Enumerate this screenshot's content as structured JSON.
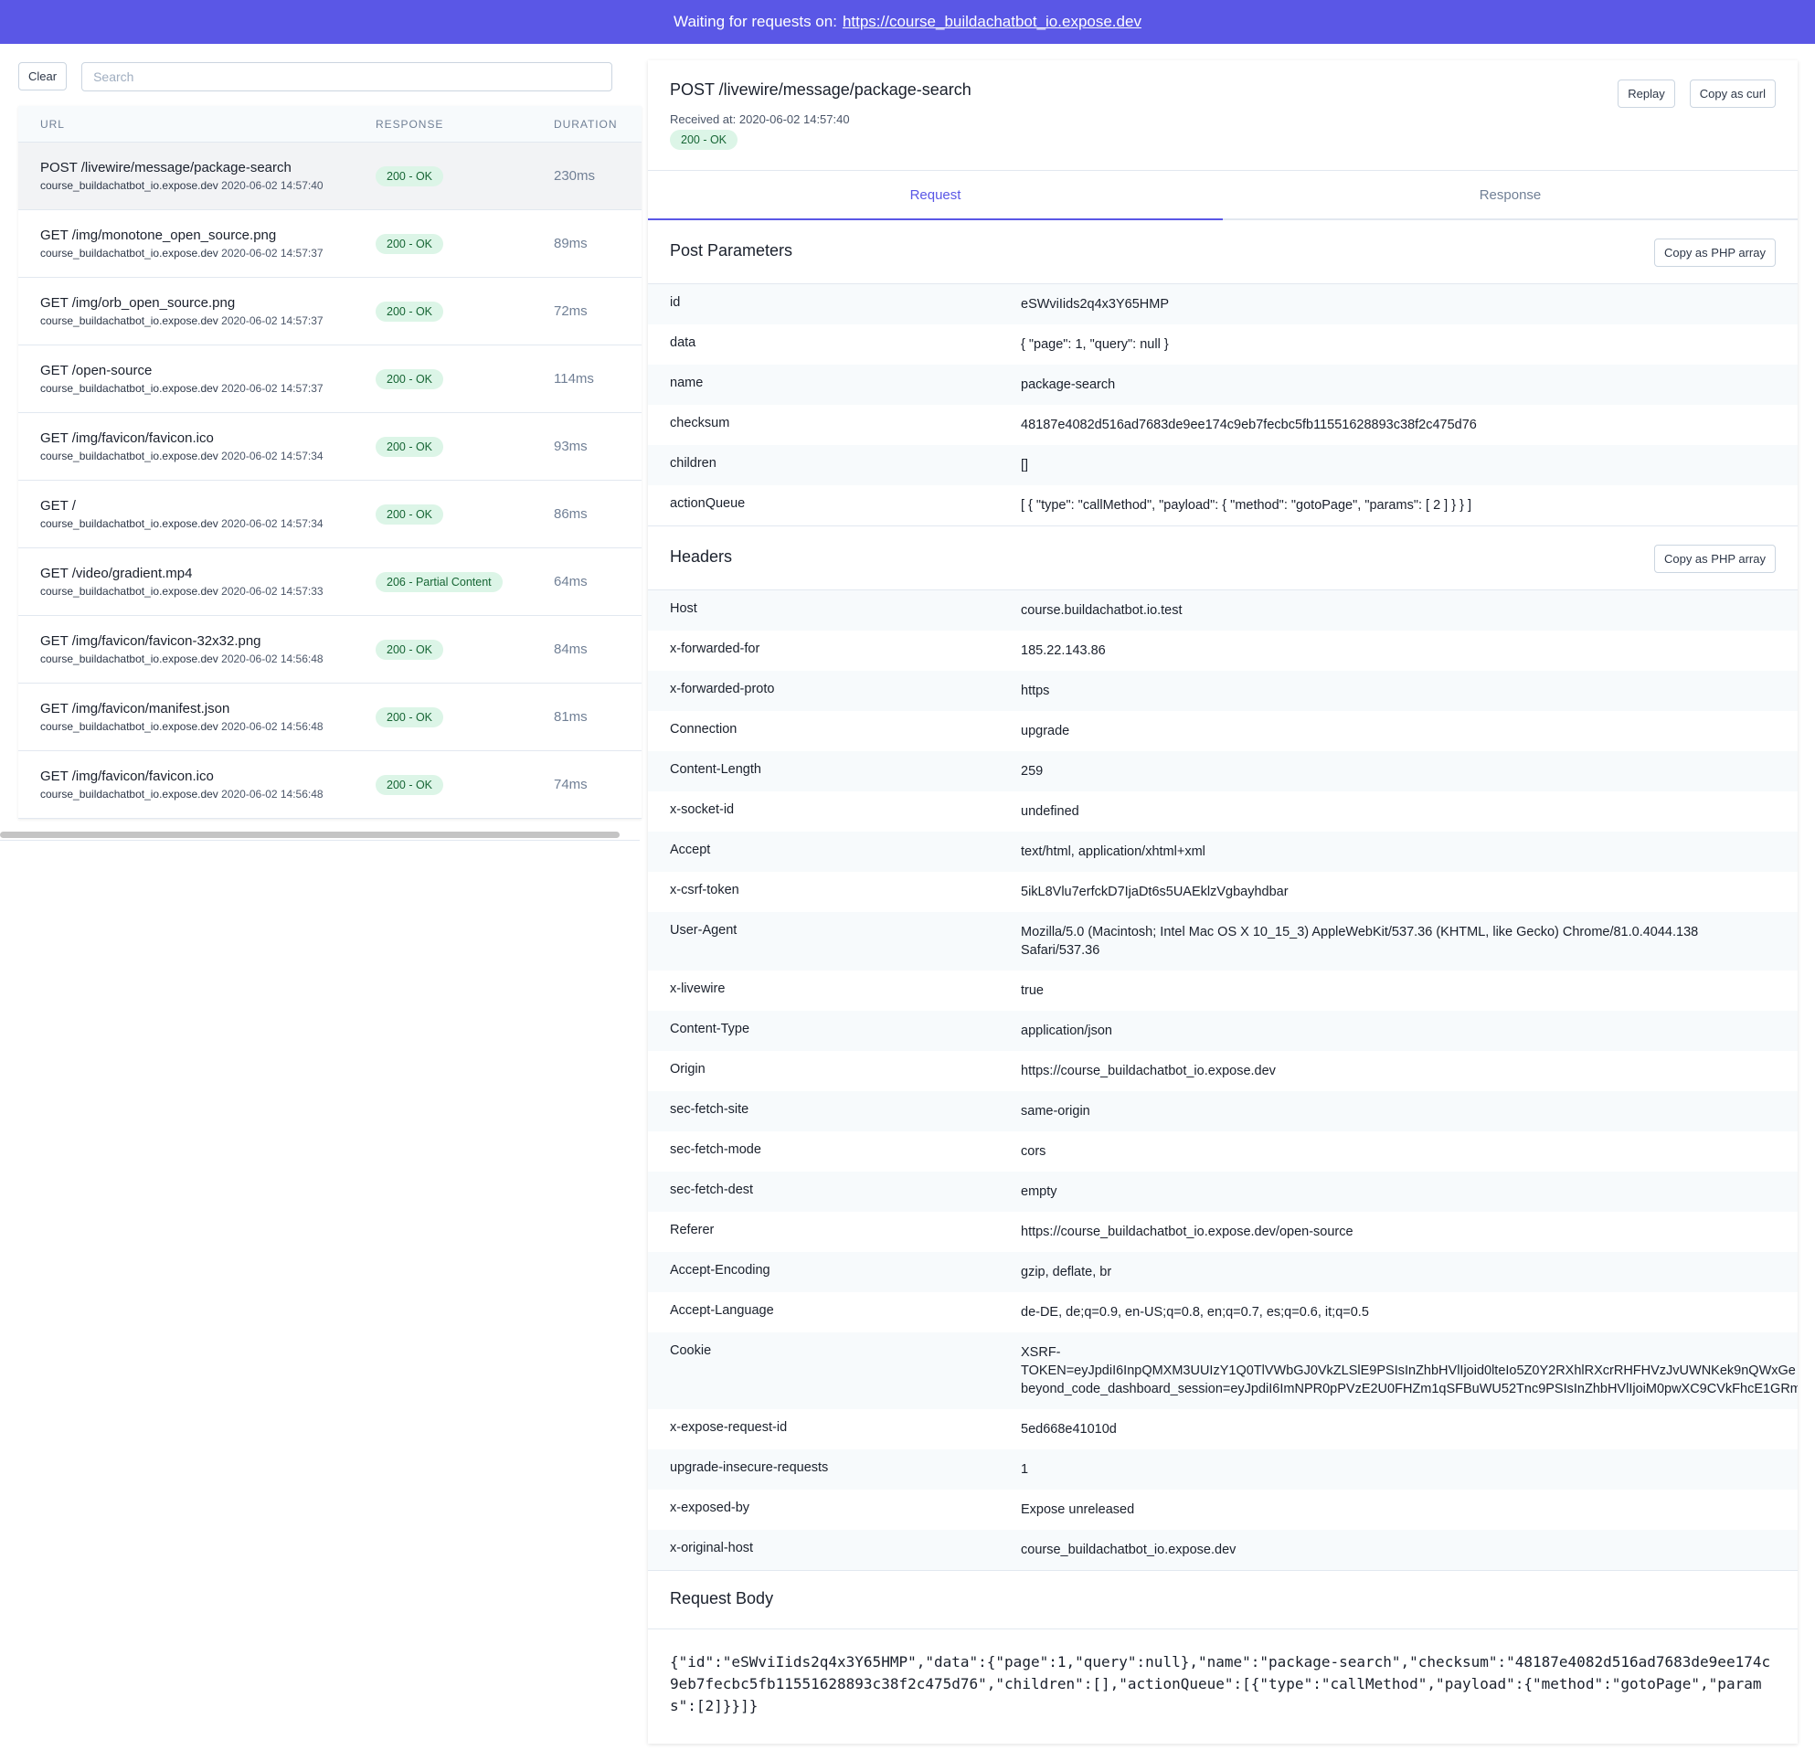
{
  "topbar": {
    "prefix": "Waiting for requests on:",
    "url": "https://course_buildachatbot_io.expose.dev"
  },
  "sidebar": {
    "clear_label": "Clear",
    "search_placeholder": "Search",
    "columns": {
      "url": "URL",
      "response": "RESPONSE",
      "duration": "DURATION"
    },
    "requests": [
      {
        "method_path": "POST /livewire/message/package-search",
        "host": "course_buildachatbot_io.expose.dev",
        "time": "2020-06-02 14:57:40",
        "status": "200 - OK",
        "duration": "230ms"
      },
      {
        "method_path": "GET /img/monotone_open_source.png",
        "host": "course_buildachatbot_io.expose.dev",
        "time": "2020-06-02 14:57:37",
        "status": "200 - OK",
        "duration": "89ms"
      },
      {
        "method_path": "GET /img/orb_open_source.png",
        "host": "course_buildachatbot_io.expose.dev",
        "time": "2020-06-02 14:57:37",
        "status": "200 - OK",
        "duration": "72ms"
      },
      {
        "method_path": "GET /open-source",
        "host": "course_buildachatbot_io.expose.dev",
        "time": "2020-06-02 14:57:37",
        "status": "200 - OK",
        "duration": "114ms"
      },
      {
        "method_path": "GET /img/favicon/favicon.ico",
        "host": "course_buildachatbot_io.expose.dev",
        "time": "2020-06-02 14:57:34",
        "status": "200 - OK",
        "duration": "93ms"
      },
      {
        "method_path": "GET /",
        "host": "course_buildachatbot_io.expose.dev",
        "time": "2020-06-02 14:57:34",
        "status": "200 - OK",
        "duration": "86ms"
      },
      {
        "method_path": "GET /video/gradient.mp4",
        "host": "course_buildachatbot_io.expose.dev",
        "time": "2020-06-02 14:57:33",
        "status": "206 - Partial Content",
        "duration": "64ms"
      },
      {
        "method_path": "GET /img/favicon/favicon-32x32.png",
        "host": "course_buildachatbot_io.expose.dev",
        "time": "2020-06-02 14:56:48",
        "status": "200 - OK",
        "duration": "84ms"
      },
      {
        "method_path": "GET /img/favicon/manifest.json",
        "host": "course_buildachatbot_io.expose.dev",
        "time": "2020-06-02 14:56:48",
        "status": "200 - OK",
        "duration": "81ms"
      },
      {
        "method_path": "GET /img/favicon/favicon.ico",
        "host": "course_buildachatbot_io.expose.dev",
        "time": "2020-06-02 14:56:48",
        "status": "200 - OK",
        "duration": "74ms"
      }
    ]
  },
  "detail": {
    "title": "POST /livewire/message/package-search",
    "received": "Received at: 2020-06-02 14:57:40",
    "status": "200 - OK",
    "replay_label": "Replay",
    "copy_curl_label": "Copy as curl",
    "tabs": {
      "request": "Request",
      "response": "Response"
    },
    "post_params": {
      "title": "Post Parameters",
      "copy_label": "Copy as PHP array",
      "rows": [
        {
          "key": "id",
          "value": "eSWviIids2q4x3Y65HMP"
        },
        {
          "key": "data",
          "value": "{ \"page\": 1, \"query\": null }"
        },
        {
          "key": "name",
          "value": "package-search"
        },
        {
          "key": "checksum",
          "value": "48187e4082d516ad7683de9ee174c9eb7fecbc5fb11551628893c38f2c475d76"
        },
        {
          "key": "children",
          "value": "[]"
        },
        {
          "key": "actionQueue",
          "value": "[ { \"type\": \"callMethod\", \"payload\": { \"method\": \"gotoPage\", \"params\": [ 2 ] } } ]"
        }
      ]
    },
    "headers": {
      "title": "Headers",
      "copy_label": "Copy as PHP array",
      "rows": [
        {
          "key": "Host",
          "value": "course.buildachatbot.io.test"
        },
        {
          "key": "x-forwarded-for",
          "value": "185.22.143.86"
        },
        {
          "key": "x-forwarded-proto",
          "value": "https"
        },
        {
          "key": "Connection",
          "value": "upgrade"
        },
        {
          "key": "Content-Length",
          "value": "259"
        },
        {
          "key": "x-socket-id",
          "value": "undefined"
        },
        {
          "key": "Accept",
          "value": "text/html, application/xhtml+xml"
        },
        {
          "key": "x-csrf-token",
          "value": "5ikL8Vlu7erfckD7IjaDt6s5UAEklzVgbayhdbar"
        },
        {
          "key": "User-Agent",
          "value": "Mozilla/5.0 (Macintosh; Intel Mac OS X 10_15_3) AppleWebKit/537.36 (KHTML, like Gecko) Chrome/81.0.4044.138 Safari/537.36"
        },
        {
          "key": "x-livewire",
          "value": "true"
        },
        {
          "key": "Content-Type",
          "value": "application/json"
        },
        {
          "key": "Origin",
          "value": "https://course_buildachatbot_io.expose.dev"
        },
        {
          "key": "sec-fetch-site",
          "value": "same-origin"
        },
        {
          "key": "sec-fetch-mode",
          "value": "cors"
        },
        {
          "key": "sec-fetch-dest",
          "value": "empty"
        },
        {
          "key": "Referer",
          "value": "https://course_buildachatbot_io.expose.dev/open-source"
        },
        {
          "key": "Accept-Encoding",
          "value": "gzip, deflate, br"
        },
        {
          "key": "Accept-Language",
          "value": "de-DE, de;q=0.9, en-US;q=0.8, en;q=0.7, es;q=0.6, it;q=0.5"
        },
        {
          "key": "Cookie",
          "value_lines": [
            "XSRF-",
            "TOKEN=eyJpdiI6InpQMXM3UUIzY1Q0TlVWbGJ0VkZLSlE9PSIsInZhbHVlIjoid0lteIo5Z0Y2RXhlRXcrRHFHVzJvUWNKek9nQWxGe",
            "beyond_code_dashboard_session=eyJpdiI6ImNPR0pPVzE2U0FHZm1qSFBuWU52Tnc9PSIsInZhbHVlIjoiM0pwXC9CVkFhcE1GRm"
          ]
        },
        {
          "key": "x-expose-request-id",
          "value": "5ed668e41010d"
        },
        {
          "key": "upgrade-insecure-requests",
          "value": "1"
        },
        {
          "key": "x-exposed-by",
          "value": "Expose unreleased"
        },
        {
          "key": "x-original-host",
          "value": "course_buildachatbot_io.expose.dev"
        }
      ]
    },
    "body": {
      "title": "Request Body",
      "content": "{\"id\":\"eSWviIids2q4x3Y65HMP\",\"data\":{\"page\":1,\"query\":null},\"name\":\"package-search\",\"checksum\":\"48187e4082d516ad7683de9ee174c9eb7fecbc5fb11551628893c38f2c475d76\",\"children\":[],\"actionQueue\":[{\"type\":\"callMethod\",\"payload\":{\"method\":\"gotoPage\",\"params\":[2]}}]}"
    }
  }
}
